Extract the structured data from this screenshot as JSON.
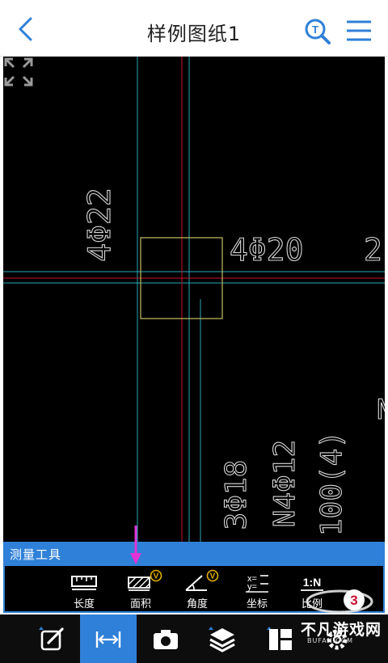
{
  "header": {
    "title": "样例图纸1"
  },
  "drawing": {
    "labels": {
      "top_left_vertical": "4Φ22",
      "right_of_box": "4Φ20",
      "far_right_partial": "2",
      "right_edge_partial": "N",
      "bottom_1": "3Φ18",
      "bottom_2": "N4Φ12",
      "bottom_3": "100(4)"
    },
    "colors": {
      "axis_red": "#c8102e",
      "axis_cyan": "#2aa7b8",
      "box_olive": "#b7b25a"
    }
  },
  "tools": {
    "title": "测量工具",
    "items": [
      {
        "label": "长度",
        "icon": "ruler-icon",
        "vip": false
      },
      {
        "label": "面积",
        "icon": "area-hatch-icon",
        "vip": true
      },
      {
        "label": "角度",
        "icon": "angle-icon",
        "vip": true
      },
      {
        "label": "坐标",
        "icon": "coordinate-icon",
        "vip": false
      },
      {
        "label": "比例",
        "icon": "scale-icon",
        "vip": false,
        "glyph": "1:N"
      }
    ]
  },
  "nav": {
    "items": [
      {
        "icon": "edit-icon",
        "active": false
      },
      {
        "icon": "measure-icon",
        "active": true
      },
      {
        "icon": "camera-icon",
        "active": false
      },
      {
        "icon": "layers-icon",
        "active": false
      },
      {
        "icon": "layout-icon",
        "active": false
      },
      {
        "icon": "settings-icon",
        "active": false
      }
    ]
  },
  "watermark": {
    "text": "不凡游戏网",
    "url": "BUFAN.COM"
  },
  "accent": "#2f80d8"
}
